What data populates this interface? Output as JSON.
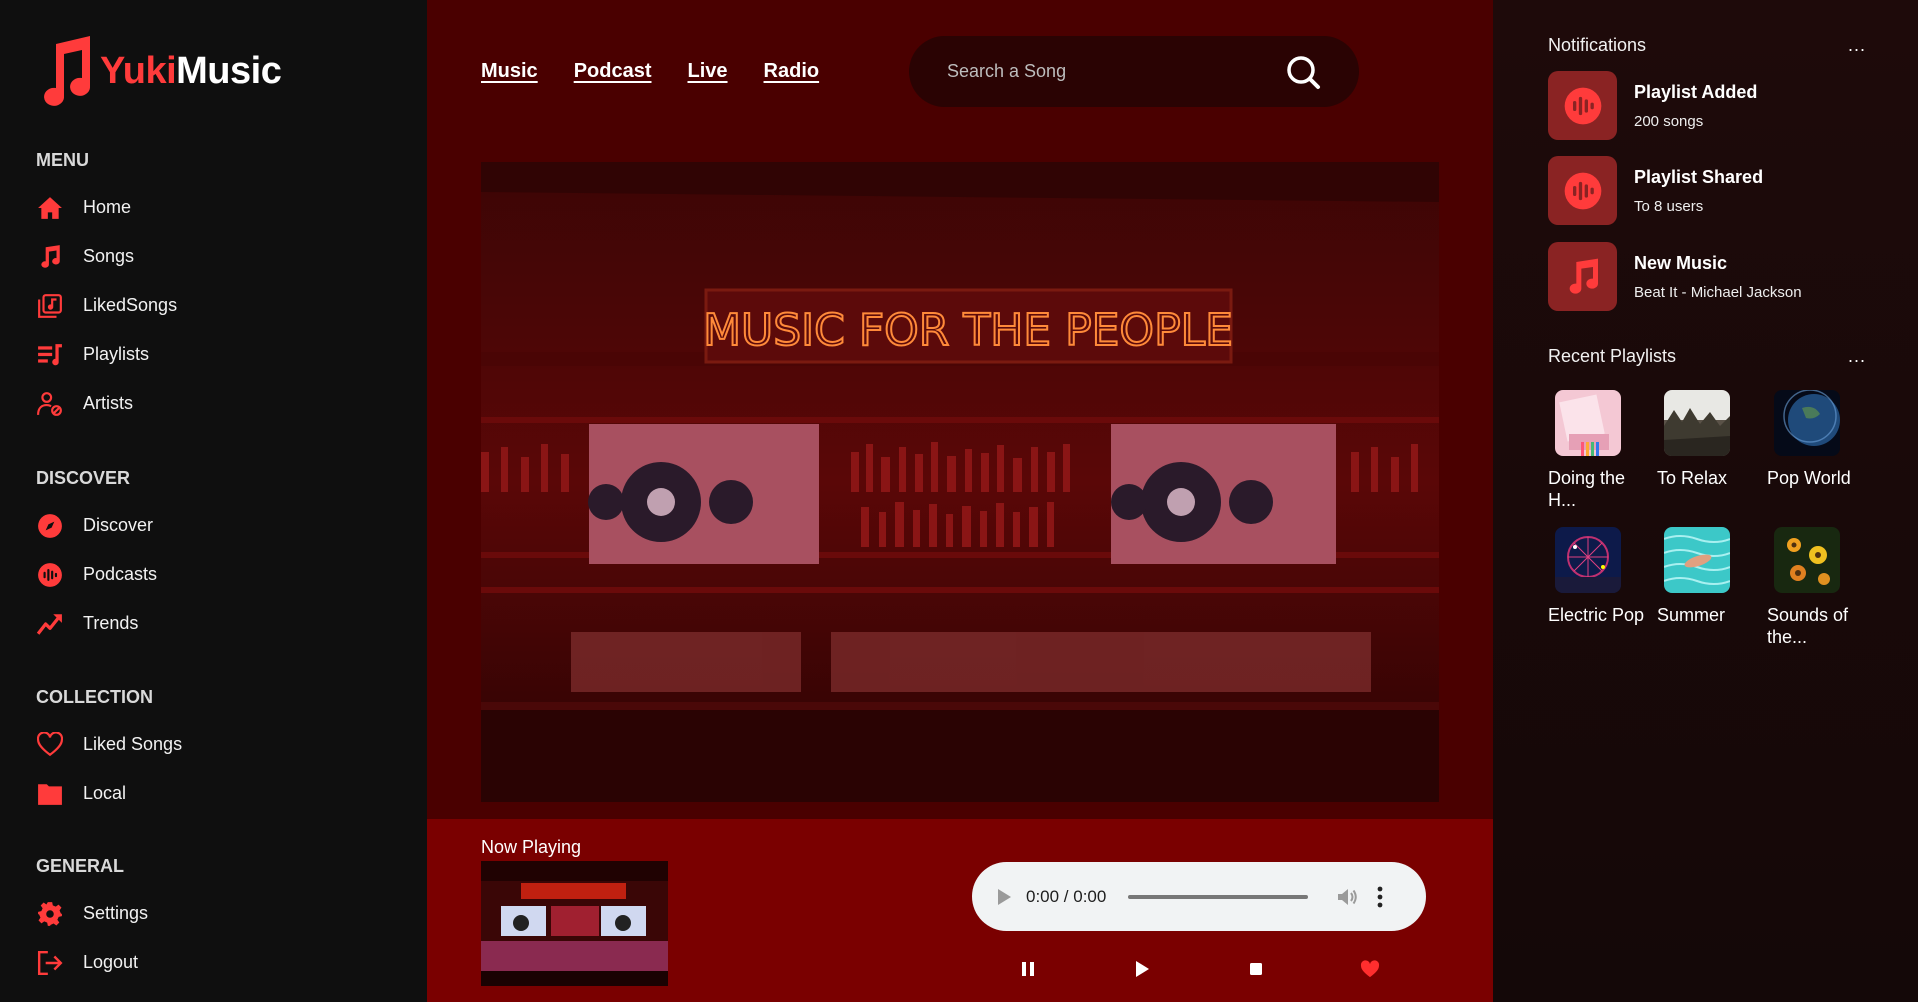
{
  "app": {
    "brand_part1": "Yuki",
    "brand_part2": "Music",
    "accent": "#ff3b3b"
  },
  "sidebar": {
    "sections": [
      {
        "heading": "MENU",
        "items": [
          {
            "label": "Home",
            "icon": "home-icon"
          },
          {
            "label": "Songs",
            "icon": "music-note-icon"
          },
          {
            "label": "LikedSongs",
            "icon": "music-library-icon"
          },
          {
            "label": "Playlists",
            "icon": "playlist-icon"
          },
          {
            "label": "Artists",
            "icon": "artist-icon"
          }
        ]
      },
      {
        "heading": "DISCOVER",
        "items": [
          {
            "label": "Discover",
            "icon": "compass-icon"
          },
          {
            "label": "Podcasts",
            "icon": "podcast-icon"
          },
          {
            "label": "Trends",
            "icon": "trend-up-icon"
          }
        ]
      },
      {
        "heading": "COLLECTION",
        "items": [
          {
            "label": "Liked Songs",
            "icon": "heart-icon"
          },
          {
            "label": "Local",
            "icon": "folder-icon"
          }
        ]
      },
      {
        "heading": "GENERAL",
        "items": [
          {
            "label": "Settings",
            "icon": "gear-icon"
          },
          {
            "label": "Logout",
            "icon": "logout-icon"
          }
        ]
      }
    ]
  },
  "header": {
    "tabs": [
      "Music",
      "Podcast",
      "Live",
      "Radio"
    ],
    "search_placeholder": "Search a Song"
  },
  "hero": {
    "sign_text": "MUSIC FOR THE PEOPLE"
  },
  "player": {
    "now_playing_label": "Now Playing",
    "time_display": "0:00 / 0:00",
    "controls": [
      "pause-icon",
      "play-icon",
      "stop-icon",
      "heart-icon"
    ]
  },
  "notifications": {
    "title": "Notifications",
    "more": "...",
    "items": [
      {
        "title": "Playlist Added",
        "subtitle": "200 songs",
        "icon": "podcast-icon"
      },
      {
        "title": "Playlist Shared",
        "subtitle": "To 8 users",
        "icon": "podcast-icon"
      },
      {
        "title": "New Music",
        "subtitle": "Beat It - Michael Jackson",
        "icon": "music-note-icon"
      }
    ]
  },
  "recent_playlists": {
    "title": "Recent Playlists",
    "more": "...",
    "items": [
      {
        "name": "Doing the H...",
        "theme": "pink-notes"
      },
      {
        "name": "To Relax",
        "theme": "misty-forest"
      },
      {
        "name": "Pop World",
        "theme": "earth"
      },
      {
        "name": "Electric Pop",
        "theme": "ferris-wheel"
      },
      {
        "name": "Summer",
        "theme": "pool"
      },
      {
        "name": "Sounds of the...",
        "theme": "flowers"
      }
    ]
  }
}
